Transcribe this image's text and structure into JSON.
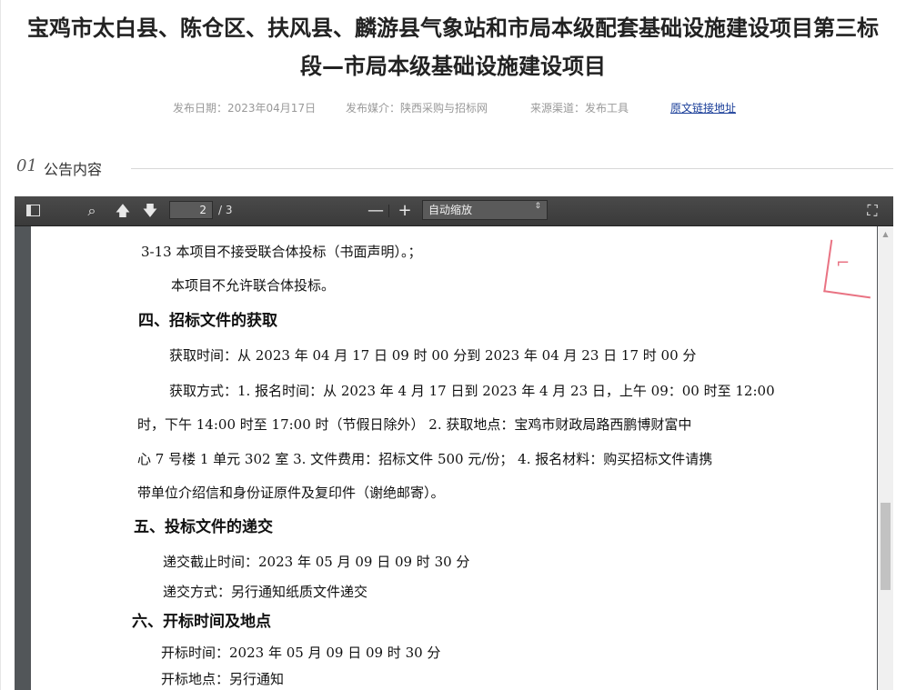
{
  "article": {
    "title_line1": "宝鸡市太白县、陈仓区、扶风县、麟游县气象站和市局本级配套基础设施建设项目第三标",
    "title_line2": "段—市局本级基础设施建设项目",
    "publish_date": "发布日期：2023年04月17日",
    "publish_media": "发布媒介：陕西采购与招标网",
    "source_channel": "来源渠道：发布工具",
    "source_link": "原文链接地址"
  },
  "section": {
    "number": "01",
    "title": "公告内容"
  },
  "viewer": {
    "page_value": "2",
    "page_total": "/ 3",
    "zoom_selected": "自动缩放",
    "icons": {
      "sidebar": "sidebar-toggle-icon",
      "search": "search-icon",
      "prev": "arrow-up-icon",
      "next": "arrow-down-icon",
      "zoom_out": "minus-icon",
      "zoom_in": "plus-icon",
      "fullscreen": "fullscreen-icon"
    },
    "search_glyph": "⌕",
    "prev_glyph": "🡅",
    "next_glyph": "🡇",
    "minus_glyph": "—",
    "plus_glyph": "+",
    "fullscreen_glyph": "⛶",
    "zoom_arrows": "⇕"
  },
  "document": {
    "lines": [
      "3-13 本项目不接受联合体投标（书面声明）。；",
      "本项目不允许联合体投标。",
      "四、招标文件的获取",
      "获取时间：从 2023 年 04 月 17 日  09 时 00 分到 2023 年 04 月 23 日  17 时 00 分",
      "获取方式：1. 报名时间：从 2023 年 4 月 17 日到 2023 年 4 月 23 日，上午 09：00 时至 12:00",
      "时，下午 14:00 时至 17:00 时（节假日除外）   2. 获取地点：宝鸡市财政局路西鹏博财富中",
      "心 7 号楼 1 单元 302 室 3. 文件费用：招标文件 500 元/份；  4. 报名材料：购买招标文件请携",
      "带单位介绍信和身份证原件及复印件（谢绝邮寄）。",
      "五、投标文件的递交",
      "递交截止时间：2023 年 05 月 09 日  09 时 30 分",
      "递交方式：另行通知纸质文件递交",
      "六、开标时间及地点",
      "开标时间：2023 年 05 月 09 日  09 时 30 分",
      "开标地点：另行通知"
    ]
  },
  "colors": {
    "link": "#1a3e99",
    "toolbar": "#3f3f3f",
    "stamp": "#e2455a"
  }
}
